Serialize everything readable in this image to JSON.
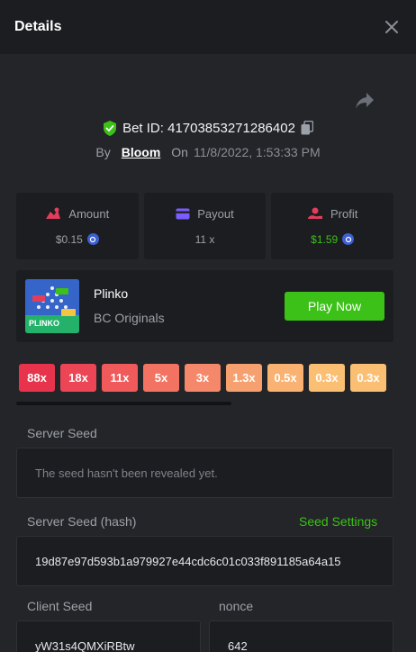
{
  "header": {
    "title": "Details"
  },
  "bet": {
    "id_label": "Bet ID: 41703853271286402",
    "by": "By",
    "user": "Bloom",
    "on": "On",
    "date": "11/8/2022, 1:53:33 PM"
  },
  "stats": {
    "amount": {
      "label": "Amount",
      "value": "$0.15"
    },
    "payout": {
      "label": "Payout",
      "value": "11 x"
    },
    "profit": {
      "label": "Profit",
      "value": "$1.59"
    }
  },
  "game": {
    "name": "Plinko",
    "provider": "BC Originals",
    "play_label": "Play Now",
    "thumb_title": "PLINKO"
  },
  "multipliers": [
    "88x",
    "18x",
    "11x",
    "5x",
    "3x",
    "1.3x",
    "0.5x",
    "0.3x",
    "0.3x"
  ],
  "multiplier_colors": [
    "#e7344c",
    "#ec4556",
    "#f05a5a",
    "#f37363",
    "#f5886a",
    "#f7a06f",
    "#f9b271",
    "#fbbf74",
    "#fbbf74"
  ],
  "seeds": {
    "server_seed_label": "Server Seed",
    "server_seed_value": "The seed hasn't been revealed yet.",
    "server_hash_label": "Server Seed (hash)",
    "seed_settings": "Seed Settings",
    "server_hash_value": "19d87e97d593b1a979927e44cdc6c01c033f891185a64a15",
    "client_seed_label": "Client Seed",
    "client_seed_value": "yW31s4QMXiRBtw",
    "nonce_label": "nonce",
    "nonce_value": "642"
  },
  "colors": {
    "green": "#3bc117",
    "accent_red": "#e23d5b",
    "accent_purple": "#7b5cff"
  }
}
